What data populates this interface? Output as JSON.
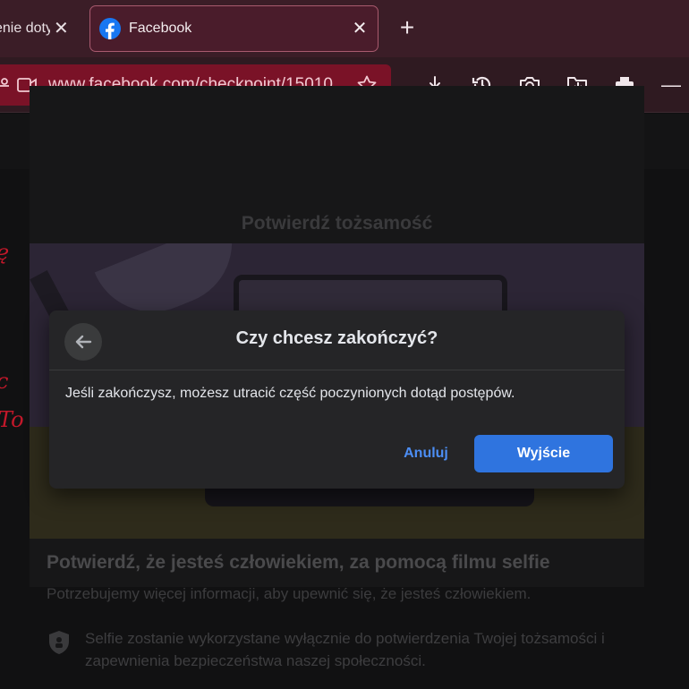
{
  "browser": {
    "tabs": [
      {
        "label": "enie doty",
        "close": "✕",
        "active": false
      },
      {
        "label": "Facebook",
        "close": "✕",
        "active": true
      }
    ],
    "new_tab": "+",
    "url": "www.facebook.com/checkpoint/15010",
    "toolbar_icons": [
      "download-icon",
      "history-icon",
      "camera-icon",
      "folder-download-icon",
      "print-icon",
      "minimize-icon"
    ],
    "minimize": "—"
  },
  "page": {
    "card_title": "Potwierdź tożsamość",
    "section_title": "Potwierdź, że jesteś człowiekiem, za pomocą filmu selfie",
    "section_subtitle": "Potrzebujemy więcej informacji, aby upewnić się, że jesteś człowiekiem.",
    "bullet_text": "Selfie zostanie wykorzystane wyłącznie do potwierdzenia Twojej tożsamości i zapewnienia bezpieczeństwa naszej społeczności."
  },
  "dialog": {
    "title": "Czy chcesz zakończyć?",
    "body": "Jeśli zakończysz, możesz utracić część poczynionych dotąd postępów.",
    "cancel_label": "Anuluj",
    "exit_label": "Wyjście"
  },
  "colors": {
    "accent": "#2f74df",
    "link": "#4c8ef5",
    "facebook_blue": "#1877f2",
    "url_bar": "#7a1227"
  }
}
